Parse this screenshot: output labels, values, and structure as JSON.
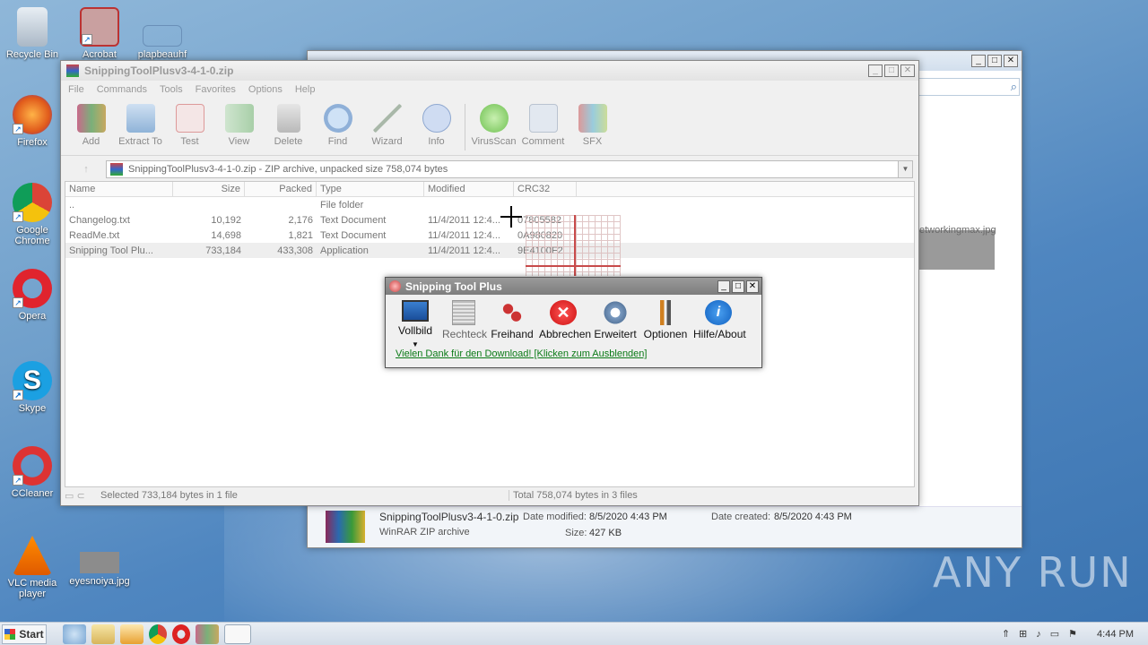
{
  "desktop": {
    "icons": [
      {
        "label": "Recycle Bin",
        "icon": "recycle-bin-icon"
      },
      {
        "label": "Firefox",
        "icon": "firefox-icon"
      },
      {
        "label": "Google Chrome",
        "icon": "chrome-icon"
      },
      {
        "label": "Opera",
        "icon": "opera-icon"
      },
      {
        "label": "Skype",
        "icon": "skype-icon"
      },
      {
        "label": "CCleaner",
        "icon": "ccleaner-icon"
      },
      {
        "label": "VLC media player",
        "icon": "vlc-icon"
      },
      {
        "label": "Acrobat",
        "icon": "acrobat-icon"
      },
      {
        "label": "plapbeauhf",
        "icon": "file-icon"
      },
      {
        "label": "eyesnoiya.jpg",
        "icon": "image-file-icon"
      }
    ]
  },
  "explorer_bg": {
    "file_name": "SnippingToolPlusv3-4-1-0.zip",
    "date_modified_label": "Date modified:",
    "date_modified": "8/5/2020 4:43 PM",
    "date_created_label": "Date created:",
    "date_created": "8/5/2020 4:43 PM",
    "file_type": "WinRAR ZIP archive",
    "size_label": "Size:",
    "size": "427 KB",
    "thumb_label": "etworkingmax.jpg"
  },
  "winrar": {
    "title": "SnippingToolPlusv3-4-1-0.zip",
    "menu": [
      "File",
      "Commands",
      "Tools",
      "Favorites",
      "Options",
      "Help"
    ],
    "toolbar": [
      "Add",
      "Extract To",
      "Test",
      "View",
      "Delete",
      "Find",
      "Wizard",
      "Info",
      "VirusScan",
      "Comment",
      "SFX"
    ],
    "address": "SnippingToolPlusv3-4-1-0.zip - ZIP archive, unpacked size 758,074 bytes",
    "columns": [
      "Name",
      "Size",
      "Packed",
      "Type",
      "Modified",
      "CRC32"
    ],
    "rows": [
      {
        "name": "..",
        "size": "",
        "packed": "",
        "type": "File folder",
        "modified": "",
        "crc": ""
      },
      {
        "name": "Changelog.txt",
        "size": "10,192",
        "packed": "2,176",
        "type": "Text Document",
        "modified": "11/4/2011 12:4...",
        "crc": "07805582"
      },
      {
        "name": "ReadMe.txt",
        "size": "14,698",
        "packed": "1,821",
        "type": "Text Document",
        "modified": "11/4/2011 12:4...",
        "crc": "0A980820"
      },
      {
        "name": "Snipping Tool Plu...",
        "size": "733,184",
        "packed": "433,308",
        "type": "Application",
        "modified": "11/4/2011 12:4...",
        "crc": "9E4100F2"
      }
    ],
    "status_left": "Selected 733,184 bytes in 1 file",
    "status_right": "Total 758,074 bytes in 3 files"
  },
  "snipping": {
    "title": "Snipping Tool Plus",
    "tools": [
      "Vollbild",
      "Rechteck",
      "Freihand",
      "Abbrechen",
      "Erweitert",
      "Optionen",
      "Hilfe/About"
    ],
    "link": "Vielen Dank für den Download! [Klicken zum Ausblenden]"
  },
  "taskbar": {
    "start": "Start",
    "time": "4:44 PM"
  },
  "watermark": "ANY RUN"
}
